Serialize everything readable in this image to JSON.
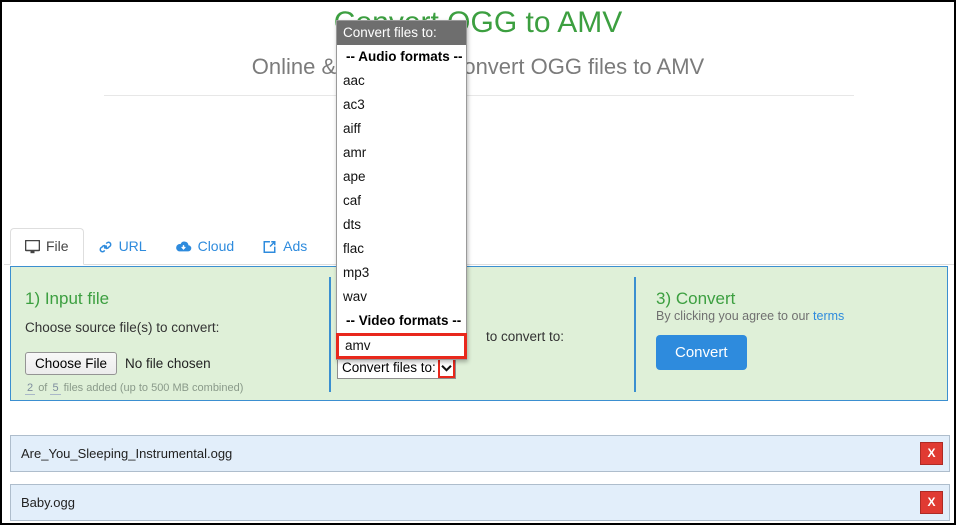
{
  "header": {
    "title": "Convert OGG to AMV",
    "subtitle": "Online & free tool to convert OGG files to AMV"
  },
  "tabs": [
    {
      "label": "File",
      "icon": "monitor-icon",
      "active": true
    },
    {
      "label": "URL",
      "icon": "link-icon",
      "active": false
    },
    {
      "label": "Cloud",
      "icon": "cloud-download-icon",
      "active": false
    },
    {
      "label": "Ads",
      "icon": "external-link-icon",
      "active": false
    }
  ],
  "input_section": {
    "title": "1) Input file",
    "prompt": "Choose source file(s) to convert:",
    "choose_button": "Choose File",
    "no_file_text": "No file chosen",
    "counter_prefix": "",
    "counter_current": "2",
    "counter_of": "of",
    "counter_max": "5",
    "counter_suffix": "files added (up to 500 MB combined)"
  },
  "output_section": {
    "trailing_text": "to convert to:",
    "select_label": "Convert files to:",
    "arrow_icon": "chevron-down-icon"
  },
  "convert_section": {
    "title": "3) Convert",
    "terms_prefix": "By clicking you agree to our",
    "terms_link": "terms",
    "convert_button": "Convert"
  },
  "dropdown": {
    "header": "Convert files to:",
    "items": [
      {
        "label": "-- Audio formats --",
        "group": true,
        "highlight": false
      },
      {
        "label": "aac",
        "group": false,
        "highlight": false
      },
      {
        "label": "ac3",
        "group": false,
        "highlight": false
      },
      {
        "label": "aiff",
        "group": false,
        "highlight": false
      },
      {
        "label": "amr",
        "group": false,
        "highlight": false
      },
      {
        "label": "ape",
        "group": false,
        "highlight": false
      },
      {
        "label": "caf",
        "group": false,
        "highlight": false
      },
      {
        "label": "dts",
        "group": false,
        "highlight": false
      },
      {
        "label": "flac",
        "group": false,
        "highlight": false
      },
      {
        "label": "mp3",
        "group": false,
        "highlight": false
      },
      {
        "label": "wav",
        "group": false,
        "highlight": false
      },
      {
        "label": "-- Video formats --",
        "group": true,
        "highlight": false
      },
      {
        "label": "amv",
        "group": false,
        "highlight": true
      }
    ]
  },
  "file_list": [
    {
      "name": "Are_You_Sleeping_Instrumental.ogg",
      "remove_label": "X"
    },
    {
      "name": "Baby.ogg",
      "remove_label": "X"
    }
  ],
  "colors": {
    "title_green": "#3c9f40",
    "link_blue": "#2e8bdd",
    "panel_green_bg": "#dff0d8",
    "panel_border_blue": "#3b8fd0",
    "highlight_red": "#e8281c",
    "remove_red": "#e03a32",
    "file_row_bg": "#e2eefa",
    "dropdown_header_gray": "#6e6e6e"
  }
}
